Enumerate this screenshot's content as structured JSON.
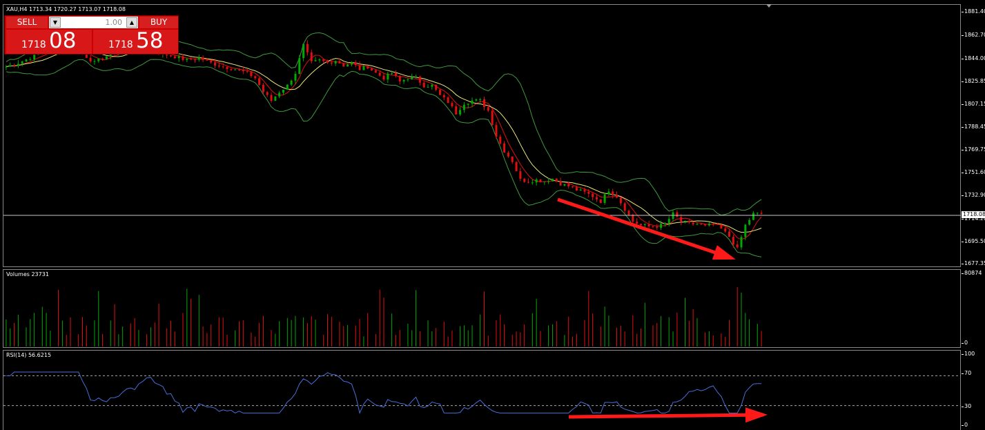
{
  "header": {
    "symbol_line": "XAU,H4  1713.34 1720.27 1713.07 1718.08"
  },
  "trade_panel": {
    "sell_label": "SELL",
    "buy_label": "BUY",
    "lot_value": "1.00",
    "sell_price_prefix": "1718",
    "sell_price_big": "08",
    "buy_price_prefix": "1718",
    "buy_price_big": "58"
  },
  "price_axis": {
    "ticks": [
      "1881.40",
      "1862.70",
      "1844.00",
      "1825.85",
      "1807.15",
      "1788.45",
      "1769.75",
      "1751.60",
      "1732.90",
      "1714.20",
      "1695.50",
      "1677.35"
    ],
    "current_price": "1718.08"
  },
  "volume_panel": {
    "label": "Volumes 23731",
    "max_label": "80874",
    "min_label": "0"
  },
  "rsi_panel": {
    "label": "RSI(14) 56.6215",
    "levels": [
      "100",
      "70",
      "30",
      "0"
    ]
  },
  "colors": {
    "up": "#00a800",
    "down": "#e01010",
    "bands": "#3f9a3f",
    "ma_fast": "#c0c0c0",
    "ma_slow": "#e8e87a",
    "rsi_line": "#4a6fd8",
    "arrow": "#ff1a1a"
  },
  "chart_data": {
    "type": "candlestick",
    "symbol": "XAU",
    "timeframe": "H4",
    "ylim": [
      1677.35,
      1881.4
    ],
    "close_path": [
      [
        0,
        1835
      ],
      [
        3,
        1838
      ],
      [
        6,
        1842
      ],
      [
        9,
        1846
      ],
      [
        12,
        1850
      ],
      [
        15,
        1852
      ],
      [
        18,
        1848
      ],
      [
        20,
        1843
      ],
      [
        22,
        1838
      ],
      [
        24,
        1842
      ],
      [
        27,
        1846
      ],
      [
        30,
        1852
      ],
      [
        33,
        1849
      ],
      [
        36,
        1848
      ],
      [
        39,
        1845
      ],
      [
        42,
        1843
      ],
      [
        45,
        1840
      ],
      [
        48,
        1842
      ],
      [
        51,
        1838
      ],
      [
        54,
        1835
      ],
      [
        57,
        1833
      ],
      [
        60,
        1830
      ],
      [
        62,
        1826
      ],
      [
        64,
        1815
      ],
      [
        66,
        1808
      ],
      [
        68,
        1815
      ],
      [
        70,
        1820
      ],
      [
        72,
        1830
      ],
      [
        74,
        1852
      ],
      [
        76,
        1838
      ],
      [
        78,
        1840
      ],
      [
        80,
        1838
      ],
      [
        82,
        1840
      ],
      [
        84,
        1836
      ],
      [
        86,
        1838
      ],
      [
        88,
        1833
      ],
      [
        90,
        1835
      ],
      [
        92,
        1830
      ],
      [
        94,
        1826
      ],
      [
        96,
        1830
      ],
      [
        98,
        1823
      ],
      [
        100,
        1826
      ],
      [
        102,
        1826
      ],
      [
        104,
        1820
      ],
      [
        106,
        1820
      ],
      [
        108,
        1812
      ],
      [
        110,
        1807
      ],
      [
        112,
        1798
      ],
      [
        114,
        1806
      ],
      [
        116,
        1808
      ],
      [
        118,
        1808
      ],
      [
        120,
        1800
      ],
      [
        122,
        1780
      ],
      [
        124,
        1768
      ],
      [
        126,
        1760
      ],
      [
        128,
        1745
      ],
      [
        130,
        1744
      ],
      [
        132,
        1745
      ],
      [
        134,
        1744
      ],
      [
        136,
        1746
      ],
      [
        138,
        1742
      ],
      [
        140,
        1740
      ],
      [
        142,
        1737
      ],
      [
        144,
        1735
      ],
      [
        146,
        1732
      ],
      [
        148,
        1728
      ],
      [
        150,
        1737
      ],
      [
        152,
        1732
      ],
      [
        154,
        1722
      ],
      [
        156,
        1712
      ],
      [
        158,
        1709
      ],
      [
        160,
        1708
      ],
      [
        162,
        1708
      ],
      [
        164,
        1710
      ],
      [
        166,
        1718
      ],
      [
        168,
        1712
      ],
      [
        170,
        1710
      ],
      [
        172,
        1710
      ],
      [
        174,
        1708
      ],
      [
        176,
        1710
      ],
      [
        178,
        1706
      ],
      [
        180,
        1700
      ],
      [
        182,
        1690
      ],
      [
        184,
        1709
      ],
      [
        186,
        1718
      ],
      [
        188,
        1718
      ]
    ],
    "rsi_levels": [
      70,
      30
    ],
    "rsi_current": 56.6215,
    "volume_max": 80874,
    "annotations": [
      "red arrow: falling price lows",
      "red arrow: rising RSI lows"
    ]
  }
}
